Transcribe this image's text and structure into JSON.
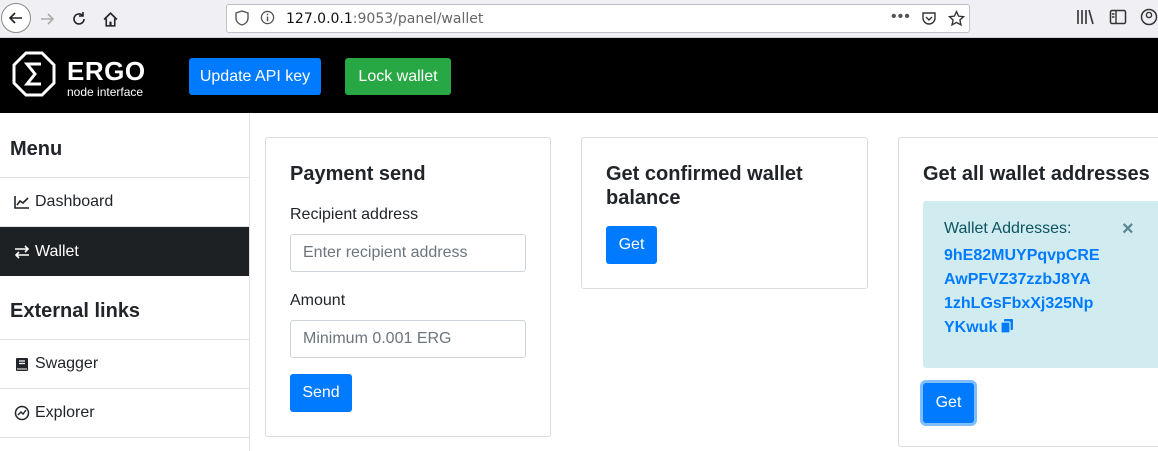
{
  "browser": {
    "url_host": "127.0.0.1",
    "url_rest": ":9053/panel/wallet"
  },
  "header": {
    "logo_title": "ERGO",
    "logo_subtitle": "node interface",
    "update_api_key_label": "Update API key",
    "lock_wallet_label": "Lock wallet"
  },
  "sidebar": {
    "menu_heading": "Menu",
    "items": [
      {
        "label": "Dashboard",
        "icon": "chart-line-icon"
      },
      {
        "label": "Wallet",
        "icon": "exchange-icon"
      }
    ],
    "external_heading": "External links",
    "external_items": [
      {
        "label": "Swagger",
        "icon": "book-icon"
      },
      {
        "label": "Explorer",
        "icon": "compass-icon"
      }
    ]
  },
  "payment_card": {
    "title": "Payment send",
    "recipient_label": "Recipient address",
    "recipient_placeholder": "Enter recipient address",
    "amount_label": "Amount",
    "amount_placeholder": "Minimum 0.001 ERG",
    "send_label": "Send"
  },
  "balance_card": {
    "title_line1": "Get confirmed wallet",
    "title_line2": "balance",
    "get_label": "Get"
  },
  "addresses_card": {
    "title": "Get all wallet addresses",
    "alert_heading": "Wallet Addresses:",
    "close_symbol": "×",
    "address_lines": [
      "9hE82MUYPqvpCRE",
      "AwPFVZ37zzbJ8YA",
      "1zhLGsFbxXj325Np",
      "YKwuk"
    ],
    "get_label": "Get"
  },
  "colors": {
    "primary": "#007bff",
    "success": "#28a745",
    "alert_bg": "#d1ecf1",
    "active_sidebar": "#1e2124"
  }
}
